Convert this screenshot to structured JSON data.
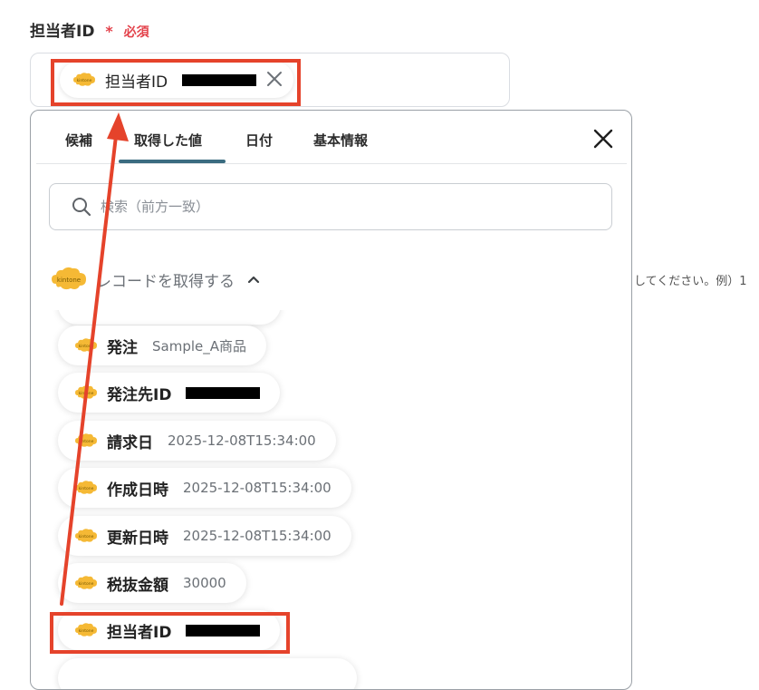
{
  "field": {
    "label": "担当者ID",
    "required_mark": "*",
    "required_text": "必須",
    "selected_chip": {
      "icon": "kintone-icon",
      "label": "担当者ID"
    }
  },
  "panel": {
    "tabs": [
      {
        "label": "候補",
        "active": false
      },
      {
        "label": "取得した値",
        "active": true
      },
      {
        "label": "日付",
        "active": false
      },
      {
        "label": "基本情報",
        "active": false
      }
    ],
    "search_placeholder": "検索（前方一致）",
    "group": {
      "icon": "kintone-icon",
      "label": "レコードを取得する",
      "expanded": true
    },
    "items": [
      {
        "name": "発注",
        "value": "Sample_A商品"
      },
      {
        "name": "発注先ID",
        "value": ""
      },
      {
        "name": "請求日",
        "value": "2025-12-08T15:34:00"
      },
      {
        "name": "作成日時",
        "value": "2025-12-08T15:34:00"
      },
      {
        "name": "更新日時",
        "value": "2025-12-08T15:34:00"
      },
      {
        "name": "税抜金額",
        "value": "30000"
      },
      {
        "name": "担当者ID",
        "value": ""
      }
    ]
  },
  "background_hint": "してください。例）1",
  "colors": {
    "highlight": "#e5432b",
    "accent_tab": "#3b6c80",
    "required": "#e3424b",
    "kintone": "#f5b935"
  }
}
